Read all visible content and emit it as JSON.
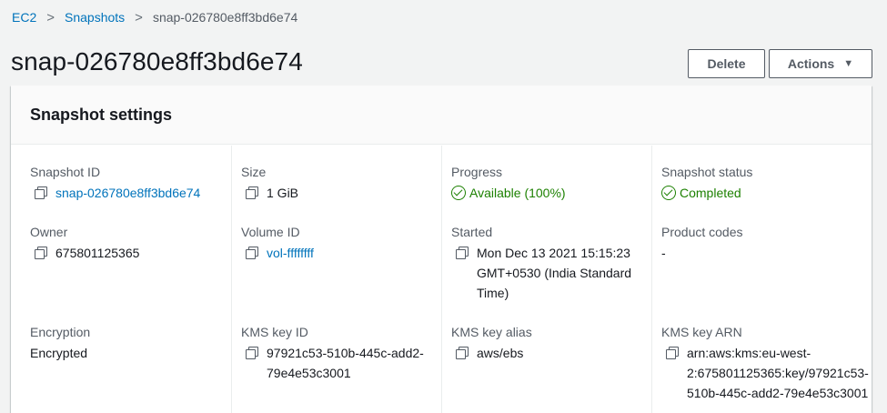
{
  "breadcrumb": {
    "items": [
      "EC2",
      "Snapshots"
    ],
    "current": "snap-026780e8ff3bd6e74",
    "separator": ">"
  },
  "page": {
    "title": "snap-026780e8ff3bd6e74"
  },
  "actions": {
    "delete_label": "Delete",
    "actions_label": "Actions"
  },
  "panel": {
    "title": "Snapshot settings"
  },
  "fields": {
    "snapshot_id": {
      "label": "Snapshot ID",
      "value": "snap-026780e8ff3bd6e74"
    },
    "size": {
      "label": "Size",
      "value": "1 GiB"
    },
    "progress": {
      "label": "Progress",
      "value": "Available (100%)"
    },
    "snapshot_status": {
      "label": "Snapshot status",
      "value": "Completed"
    },
    "owner": {
      "label": "Owner",
      "value": "675801125365"
    },
    "volume_id": {
      "label": "Volume ID",
      "value": "vol-ffffffff"
    },
    "started": {
      "label": "Started",
      "value": "Mon Dec 13 2021 15:15:23 GMT+0530 (India Standard Time)"
    },
    "product_codes": {
      "label": "Product codes",
      "value": "-"
    },
    "encryption": {
      "label": "Encryption",
      "value": "Encrypted"
    },
    "kms_key_id": {
      "label": "KMS key ID",
      "value": "97921c53-510b-445c-add2-79e4e53c3001"
    },
    "kms_key_alias": {
      "label": "KMS key alias",
      "value": "aws/ebs"
    },
    "kms_key_arn": {
      "label": "KMS key ARN",
      "value": "arn:aws:kms:eu-west-2:675801125365:key/97921c53-510b-445c-add2-79e4e53c3001"
    }
  },
  "icons": {
    "copy": "copy-icon",
    "status": "check-circle-icon",
    "breadcrumb_sep": "chevron-right-icon",
    "dropdown": "caret-down-icon"
  },
  "colors": {
    "link": "#0073bb",
    "success": "#1d8102",
    "label": "#545b64",
    "text": "#16191f"
  }
}
